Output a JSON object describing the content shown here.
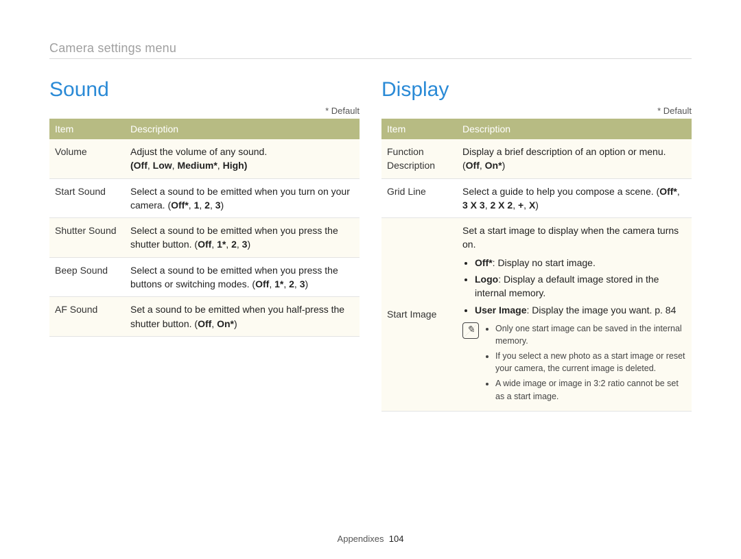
{
  "section_label": "Camera settings menu",
  "default_note": "* Default",
  "table_headers": {
    "item": "Item",
    "description": "Description"
  },
  "sound": {
    "heading": "Sound",
    "rows": [
      {
        "item": "Volume",
        "desc": "Adjust the volume of any sound.",
        "options_parts": [
          "Off",
          "Low",
          "Medium*",
          "High"
        ]
      },
      {
        "item": "Start Sound",
        "desc_prefix": "Select a sound to be emitted when you turn on your camera. (",
        "options_parts": [
          "Off*",
          "1",
          "2",
          "3"
        ],
        "desc_suffix": ")"
      },
      {
        "item": "Shutter Sound",
        "desc_prefix": "Select a sound to be emitted when you press the shutter button. (",
        "options_parts": [
          "Off",
          "1*",
          "2",
          "3"
        ],
        "desc_suffix": ")"
      },
      {
        "item": "Beep Sound",
        "desc_prefix": "Select a sound to be emitted when you press the buttons or switching modes. (",
        "options_parts": [
          "Off",
          "1*",
          "2",
          "3"
        ],
        "desc_suffix": ")"
      },
      {
        "item": "AF Sound",
        "desc_prefix": "Set a sound to be emitted when you half-press the shutter button. (",
        "options_parts": [
          "Off",
          "On*"
        ],
        "desc_suffix": ")"
      }
    ]
  },
  "display": {
    "heading": "Display",
    "rows": [
      {
        "item": "Function Description",
        "desc_prefix": "Display a brief description of an option or menu. (",
        "options_parts": [
          "Off",
          "On*"
        ],
        "desc_suffix": ")"
      },
      {
        "item": "Grid Line",
        "desc_prefix": "Select a guide to help you compose a scene. (",
        "options_parts": [
          "Off*",
          "3 X 3",
          "2 X 2",
          "+",
          "X"
        ],
        "desc_suffix": ")"
      },
      {
        "item": "Start Image",
        "desc": "Set a start image to display when the camera turns on.",
        "bullets": [
          {
            "label": "Off*",
            "text": ": Display no start image."
          },
          {
            "label": "Logo",
            "text": ": Display a default image stored in the internal memory."
          },
          {
            "label": "User Image",
            "text": ": Display the image you want. p. 84"
          }
        ],
        "notes": [
          "Only one start image can be saved in the internal memory.",
          "If you select a new photo as a start image or reset your camera, the current image is deleted.",
          "A wide image or image in 3:2 ratio cannot be set as a start image."
        ]
      }
    ]
  },
  "footer": {
    "label": "Appendixes",
    "page": "104"
  }
}
